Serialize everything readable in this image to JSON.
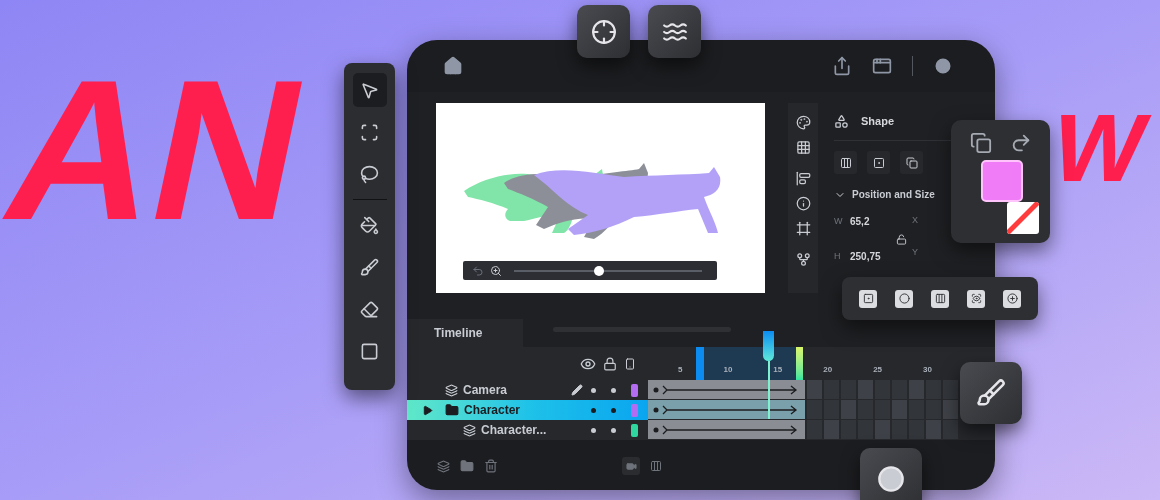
{
  "headline": {
    "left": "AN",
    "right": "W"
  },
  "tools": [
    {
      "kind": "select",
      "selected": true
    },
    {
      "kind": "transform",
      "selected": false
    },
    {
      "kind": "lasso",
      "selected": false
    },
    {
      "kind": "fill",
      "selected": false
    },
    {
      "kind": "brush",
      "selected": false
    },
    {
      "kind": "eraser",
      "selected": false
    },
    {
      "kind": "shape",
      "selected": false
    }
  ],
  "canvas": {
    "zoom": {
      "level": 0.45
    }
  },
  "properties": {
    "title": "Shape",
    "section": {
      "title": "Position and Size",
      "expanded": true
    },
    "fields": [
      {
        "label": "W",
        "value": "65,2",
        "axis": "X"
      },
      {
        "label": "H",
        "value": "250,75",
        "axis": "Y"
      }
    ]
  },
  "timeline": {
    "tab": "Timeline",
    "ruler": [
      "5",
      "10",
      "15",
      "20",
      "25",
      "30"
    ],
    "layers": [
      {
        "name": "Camera",
        "kind": "layer",
        "active": true,
        "selected": false,
        "color": "#b46cf2"
      },
      {
        "name": "Character",
        "kind": "folder",
        "active": false,
        "selected": true,
        "color": "#b46cf2",
        "children": [
          {
            "name": "Character...",
            "kind": "layer",
            "active": false,
            "selected": false,
            "color": "#2fd6a0"
          }
        ]
      }
    ]
  }
}
